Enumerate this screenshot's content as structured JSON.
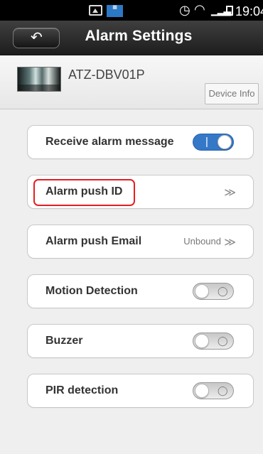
{
  "status_bar": {
    "time": "19:04",
    "signal_type": "3G",
    "icons": {
      "gallery": "gallery-icon",
      "app": "app-icon",
      "alarm": "alarm-clock-icon",
      "wifi": "wifi-icon",
      "signal": "signal-icon",
      "battery": "battery-icon"
    }
  },
  "header": {
    "title": "Alarm Settings",
    "back_icon": "back-arrow-icon"
  },
  "device": {
    "name": "ATZ-DBV01P",
    "info_button": "Device Info"
  },
  "settings": {
    "receive_alarm_message": {
      "label": "Receive alarm message",
      "state": "on"
    },
    "alarm_push_id": {
      "label": "Alarm push ID",
      "chevron": "≫"
    },
    "alarm_push_email": {
      "label": "Alarm push Email",
      "status": "Unbound",
      "chevron": "≫"
    },
    "motion_detection": {
      "label": "Motion Detection",
      "state": "off"
    },
    "buzzer": {
      "label": "Buzzer",
      "state": "off"
    },
    "pir_detection": {
      "label": "PIR detection",
      "state": "off"
    }
  },
  "colors": {
    "nav": "#2b2b2b",
    "toggle_on": "#3578c7",
    "highlight": "#e61e22",
    "background": "#efefef"
  }
}
